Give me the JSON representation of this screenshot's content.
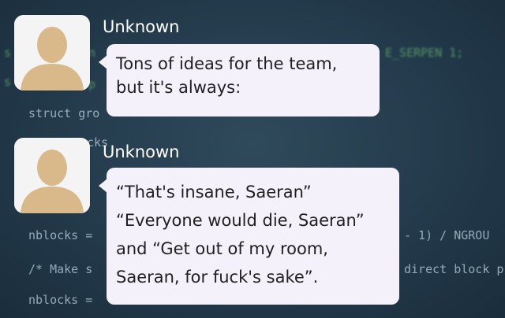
{
  "background": {
    "code_lines": [
      {
        "text": "s"
      },
      {
        "text": "n"
      },
      {
        "text": "s"
      },
      {
        "text": "p"
      },
      {
        "text": "struct gro"
      },
      {
        "text": "cks"
      },
      {
        "text": "nblocks ="
      },
      {
        "text": "- 1) / NGROU"
      },
      {
        "text": "/* Make s"
      },
      {
        "text": "direct block p"
      },
      {
        "text": "nblocks ="
      },
      {
        "text": "E_SERPEN 1;"
      }
    ]
  },
  "messages": [
    {
      "sender": "Unknown",
      "lines": [
        "Tons of ideas for the team,",
        "but it's always:"
      ]
    },
    {
      "sender": "Unknown",
      "lines": [
        "“That's insane, Saeran”",
        "“Everyone would die, Saeran”",
        "and “Get out of my room,",
        "Saeran, for fuck's sake”."
      ]
    }
  ],
  "colors": {
    "bubble": "#f4f1fb",
    "name": "#ffffff",
    "background": "#22394a",
    "avatar_figure": "#d9b88a"
  },
  "icons": {
    "avatar": "default-person-icon"
  }
}
